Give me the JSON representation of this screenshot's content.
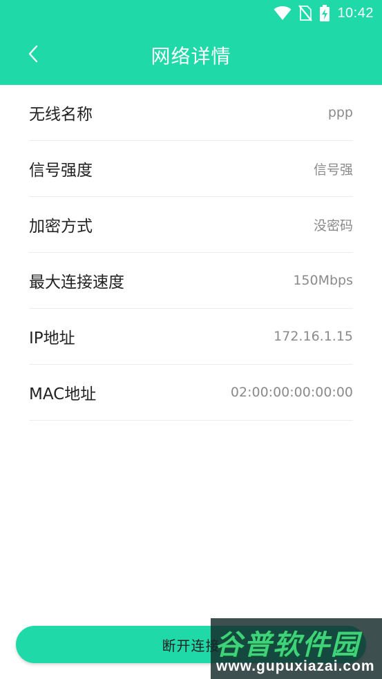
{
  "status_bar": {
    "time": "10:42",
    "icons": [
      "wifi-icon",
      "no-sim-icon",
      "battery-charging-icon"
    ]
  },
  "app_bar": {
    "title": "网络详情",
    "back_icon": "chevron-left-icon"
  },
  "details": [
    {
      "label": "无线名称",
      "value": "ppp"
    },
    {
      "label": "信号强度",
      "value": "信号强"
    },
    {
      "label": "加密方式",
      "value": "没密码"
    },
    {
      "label": "最大连接速度",
      "value": "150Mbps"
    },
    {
      "label": "IP地址",
      "value": "172.16.1.15"
    },
    {
      "label": "MAC地址",
      "value": "02:00:00:00:00:00"
    }
  ],
  "disconnect_button": {
    "label": "断开连接"
  },
  "watermark": {
    "title": "谷普软件园",
    "url": "www.gupuxiazai.com"
  },
  "colors": {
    "accent": "#1fdaa8",
    "label_text": "#222222",
    "value_text": "#8a8a8a",
    "divider": "#ececec"
  }
}
